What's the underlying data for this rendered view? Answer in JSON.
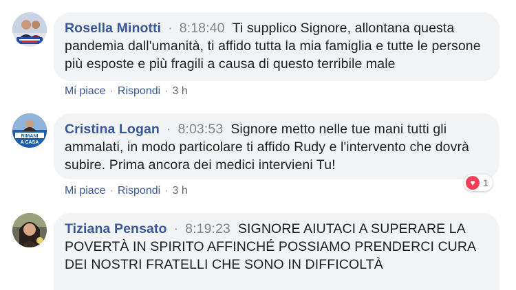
{
  "comments": [
    {
      "author": "Rosella Minotti",
      "time": "8:18:40",
      "text": "Ti supplico Signore, allontana questa pandemia dall'umanità, ti affido tutta la mia famiglia e tutte le persone più esposte e più fragili a causa di questo terribile male",
      "like_label": "Mi piace",
      "reply_label": "Rispondi",
      "age": "3 h"
    },
    {
      "author": "Cristina Logan",
      "time": "8:03:53",
      "text": "Signore metto nelle tue mani tutti gli ammalati, in modo particolare ti affido Rudy e l'intervento che dovrà subire. Prima ancora dei medici intervieni Tu!",
      "like_label": "Mi piace",
      "reply_label": "Rispondi",
      "age": "3 h",
      "reaction_icon": "heart-icon",
      "reaction_count": "1"
    },
    {
      "author": "Tiziana Pensato",
      "time": "8:19:23",
      "text": "SIGNORE AIUTACI A SUPERARE LA POVERTÀ IN SPIRITO AFFINCHÉ POSSIAMO PRENDERCI CURA DEI NOSTRI FRATELLI CHE SONO IN DIFFICOLTÀ"
    }
  ],
  "avatars": {
    "second_text_1": "RIMANI",
    "second_text_2": "A CASA"
  },
  "separator": "·",
  "colors": {
    "author": "#385898",
    "bubble": "#f2f3f5",
    "link": "#385898",
    "heart": "#f33e58"
  }
}
